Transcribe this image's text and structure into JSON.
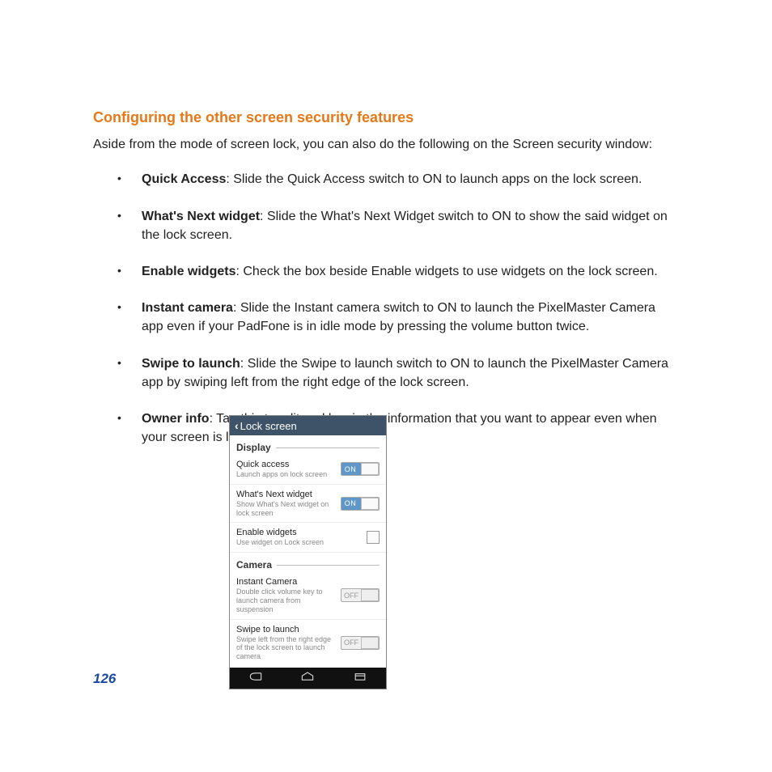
{
  "heading": "Configuring the other screen security features",
  "intro": "Aside from the mode of screen lock, you can also do the following on the Screen security window:",
  "bullets": [
    {
      "term": "Quick Access",
      "desc": ": Slide the Quick Access switch to ON to launch apps on the lock screen."
    },
    {
      "term": "What's Next widget",
      "desc": ": Slide the What's Next Widget switch to ON to show the said widget on the lock screen."
    },
    {
      "term": "Enable widgets",
      "desc": ": Check the box beside Enable widgets to use widgets on the lock screen."
    },
    {
      "term": "Instant camera",
      "desc": ":  Slide the Instant camera switch to ON to launch the PixelMaster Camera app even if your PadFone is in idle mode by pressing the volume button twice."
    },
    {
      "term": "Swipe to launch",
      "desc": ":  Slide the Swipe to launch switch to ON to launch the PixelMaster Camera app by swiping left from the right edge of the lock screen."
    },
    {
      "term": "Owner info",
      "desc": ":  Tap this to edit and key in the information that you want to appear even when your screen is locked."
    }
  ],
  "page_number": "126",
  "phone": {
    "title": "Lock screen",
    "sections": {
      "display": "Display",
      "camera": "Camera"
    },
    "rows": {
      "quick_access": {
        "title": "Quick access",
        "sub": "Launch apps on lock screen",
        "toggle": "ON"
      },
      "whats_next": {
        "title": "What's Next widget",
        "sub": "Show What's Next widget on lock screen",
        "toggle": "ON"
      },
      "enable_widgets": {
        "title": "Enable widgets",
        "sub": "Use widget on Lock screen"
      },
      "instant_camera": {
        "title": "Instant Camera",
        "sub": "Double click volume key to launch camera from suspension",
        "toggle": "OFF"
      },
      "swipe_launch": {
        "title": "Swipe to launch",
        "sub": "Swipe left from the right edge of the lock screen to launch camera",
        "toggle": "OFF"
      }
    }
  }
}
